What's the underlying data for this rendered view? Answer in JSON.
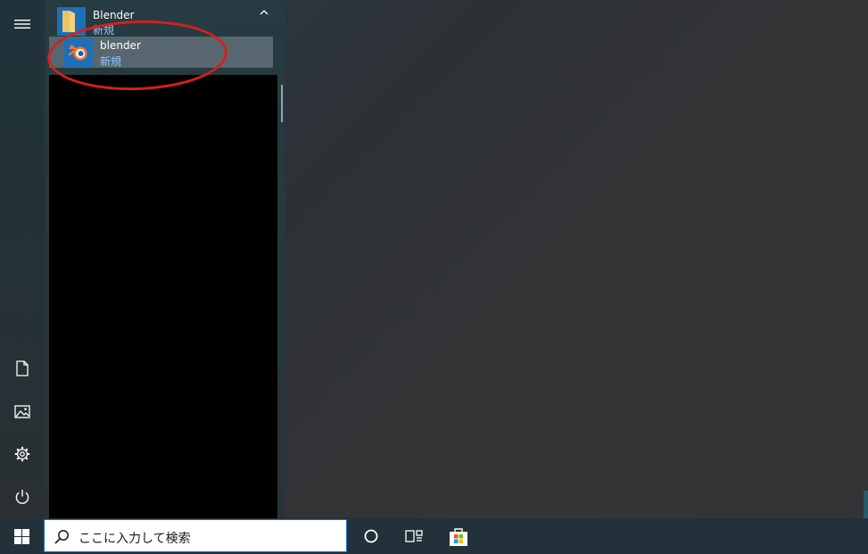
{
  "start_menu": {
    "rail": {
      "menu": "hamburger-icon",
      "documents": "document-icon",
      "pictures": "picture-icon",
      "settings": "gear-icon",
      "power": "power-icon"
    },
    "folder": {
      "name": "Blender",
      "badge": "新規",
      "icon": "folder-icon"
    },
    "app": {
      "name": "blender",
      "badge": "新規",
      "icon": "blender-logo-icon"
    }
  },
  "taskbar": {
    "search_placeholder": "ここに入力して検索",
    "icons": [
      "windows-logo-icon",
      "search-icon",
      "cortana-icon",
      "task-view-icon",
      "store-icon"
    ]
  },
  "colors": {
    "accent": "#1e6fb8",
    "badge_text": "#8ec6ff",
    "highlight_ring": "#d81e1e",
    "taskbar": "#22313a"
  }
}
